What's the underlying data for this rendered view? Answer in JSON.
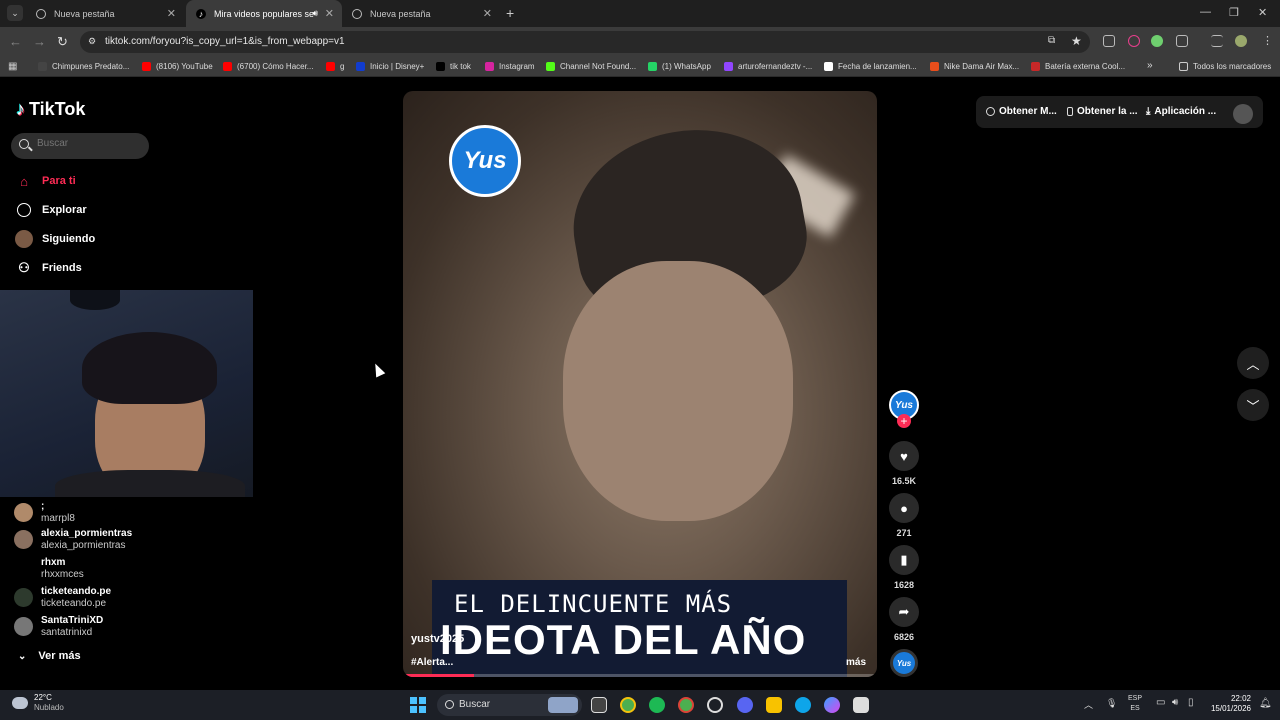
{
  "browser": {
    "tabs": [
      {
        "title": "Nueva pestaña"
      },
      {
        "title": "Mira videos populares sele"
      },
      {
        "title": "Nueva pestaña"
      }
    ],
    "url": "tiktok.com/foryou?is_copy_url=1&is_from_webapp=v1",
    "bookmarks": [
      {
        "label": "Chimpunes Predato...",
        "color": "#444444"
      },
      {
        "label": "(8106) YouTube",
        "color": "#ff0000"
      },
      {
        "label": "(6700) Cómo Hacer...",
        "color": "#ff0000"
      },
      {
        "label": "g",
        "color": "#ff0000"
      },
      {
        "label": "Inicio | Disney+",
        "color": "#113ccf"
      },
      {
        "label": "tik tok",
        "color": "#000000"
      },
      {
        "label": "Instagram",
        "color": "#d6249f"
      },
      {
        "label": "Channel Not Found...",
        "color": "#53fc18"
      },
      {
        "label": "(1) WhatsApp",
        "color": "#25d366"
      },
      {
        "label": "arturofernandeztv -...",
        "color": "#9146ff"
      },
      {
        "label": "Fecha de lanzamien...",
        "color": "#ffffff"
      },
      {
        "label": "Nike Dama Air Max...",
        "color": "#e94e1b"
      },
      {
        "label": "Batería externa Cool...",
        "color": "#c62828"
      }
    ],
    "bookmarks_more": "»",
    "all_bookmarks": "Todos los marcadores"
  },
  "tiktok": {
    "logo": "TikTok",
    "search_placeholder": "Buscar",
    "nav": [
      {
        "label": "Para ti",
        "icon": "home-icon"
      },
      {
        "label": "Explorar",
        "icon": "compass-icon"
      },
      {
        "label": "Siguiendo",
        "icon": "following-avatar-icon"
      },
      {
        "label": "Friends",
        "icon": "friends-icon"
      }
    ],
    "following": [
      {
        "name": ";",
        "handle": "marrpl8",
        "color": "#b08a6a"
      },
      {
        "name": "alexia_pormientras",
        "handle": "alexia_pormientras",
        "color": "#8a7060"
      },
      {
        "name": "rhxm",
        "handle": "rhxxmces",
        "color": "#000000"
      },
      {
        "name": "ticketeando.pe",
        "handle": "ticketeando.pe",
        "color": "#2d3a2d"
      },
      {
        "name": "SantaTriniXD",
        "handle": "santatrinixd",
        "color": "#777777"
      }
    ],
    "ver_mas": "Ver más",
    "top_buttons": [
      "Obtener M...",
      "Obtener la ...",
      "Aplicación ..."
    ],
    "video": {
      "logo_text": "Yus",
      "banner_line1": "EL DELINCUENTE MÁS",
      "banner_line2": "IDEOTA DEL AÑO",
      "username": "yustv2025",
      "hashtag": "#Alerta...",
      "more": "más",
      "progress": 0.15
    },
    "actions": {
      "likes": "16.5K",
      "comments": "271",
      "saves": "1628",
      "shares": "6826"
    }
  },
  "taskbar": {
    "temperature": "22°C",
    "condition": "Nublado",
    "search": "Buscar",
    "lang1": "ESP",
    "lang2": "ES",
    "time": "22:02",
    "date": "15/01/2026"
  }
}
